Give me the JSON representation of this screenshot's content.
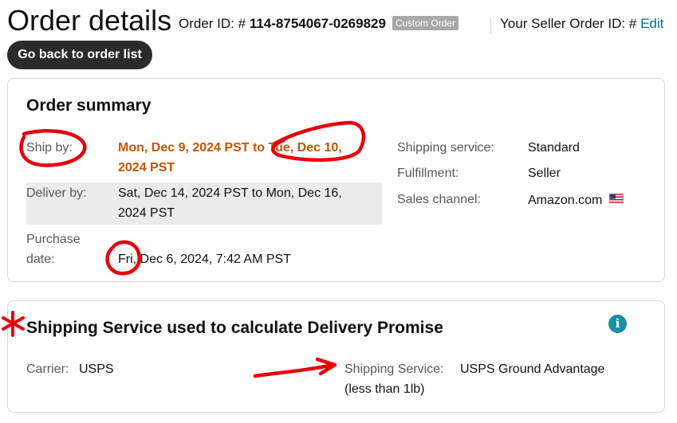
{
  "header": {
    "title": "Order details",
    "order_id_label": "Order ID: #",
    "order_id": "114-8754067-0269829",
    "badge": "Custom Order",
    "seller_order_label": "Your Seller Order ID: #",
    "edit_label": "Edit"
  },
  "back_button": {
    "label": "Go back to order list"
  },
  "order_summary": {
    "title": "Order summary",
    "ship_by": {
      "label": "Ship by:",
      "line1": "Mon, Dec 9, 2024 PST to Tue, Dec 10,",
      "line2": "2024 PST"
    },
    "deliver_by": {
      "label": "Deliver by:",
      "line1": "Sat, Dec 14, 2024 PST to Mon, Dec 16,",
      "line2": "2024 PST"
    },
    "purchase_date": {
      "label_line1": "Purchase",
      "label_line2": "date:",
      "value": "Fri, Dec 6, 2024, 7:42 AM PST"
    },
    "shipping_service": {
      "label": "Shipping service:",
      "value": "Standard"
    },
    "fulfillment": {
      "label": "Fulfillment:",
      "value": "Seller"
    },
    "sales_channel": {
      "label": "Sales channel:",
      "value": "Amazon.com"
    }
  },
  "shipping_promise": {
    "title": "Shipping Service used to calculate Delivery Promise",
    "carrier": {
      "label": "Carrier:",
      "value": "USPS"
    },
    "service": {
      "label": "Shipping Service:",
      "value_line1": "USPS Ground Advantage",
      "value_line2": "(less than 1lb)"
    },
    "info_icon": "i"
  },
  "colors": {
    "accent_link": "#007185",
    "ship_by_value": "#c45500",
    "annotation": "#e8000b",
    "button_bg": "#2b2b2b"
  },
  "icons": [
    "info-icon",
    "us-flag-icon"
  ]
}
